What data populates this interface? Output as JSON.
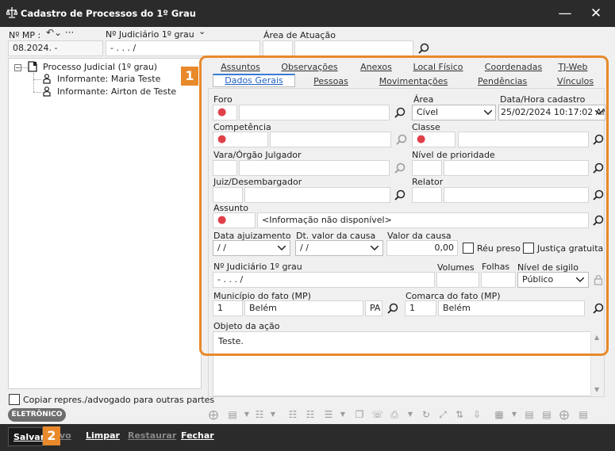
{
  "window": {
    "title": "Cadastro de Processos do 1º Grau"
  },
  "header": {
    "mp_label": "Nº MP :",
    "mp_value": "08.2024.      -",
    "nj_label": "Nº Judiciário   1º grau",
    "nj_value": "      -  .      .    .      /",
    "area_label": "Área de Atuação",
    "area_value": ""
  },
  "tree": {
    "root": "Processo Judicial (1º grau)",
    "children": [
      "Informante: Maria Teste",
      "Informante: Airton de Teste"
    ]
  },
  "copy_checkbox_label": "Copiar repres./advogado para outras partes",
  "eletronico_badge": "ELETRÔNICO",
  "tabs_top": [
    "Assuntos",
    "Observações",
    "Anexos",
    "Local Físico",
    "Coordenadas",
    "TJ-Web"
  ],
  "tabs_bottom": [
    "Dados Gerais",
    "Pessoas",
    "Movimentações",
    "Pendências",
    "Vínculos"
  ],
  "badges": {
    "one": "1",
    "two": "2"
  },
  "form": {
    "foro_label": "Foro",
    "area_label": "Área",
    "area_value": "Cível",
    "data_cad_label": "Data/Hora cadastro",
    "data_cad_value": "25/02/2024 10:17:02 AM",
    "competencia_label": "Competência",
    "classe_label": "Classe",
    "vara_label": "Vara/Órgão Julgador",
    "prioridade_label": "Nível de prioridade",
    "juiz_label": "Juiz/Desembargador",
    "relator_label": "Relator",
    "assunto_label": "Assunto",
    "assunto_value": "<Informação não disponível>",
    "data_ajuiz_label": "Data ajuizamento",
    "data_ajuiz_value": " /  /",
    "dt_valor_label": "Dt. valor da causa",
    "dt_valor_value": " /  /",
    "valor_label": "Valor da causa",
    "valor_value": "0,00",
    "reu_preso_label": "Réu preso",
    "justica_label": "Justiça gratuita",
    "nj_label": "Nº Judiciário  1º grau",
    "nj_value": "      -  .      .    .      /",
    "volumes_label": "Volumes",
    "folhas_label": "Folhas",
    "sigilo_label": "Nível de sigilo",
    "sigilo_value": "Público",
    "municipio_label": "Município do fato (MP)",
    "municipio_code": "1",
    "municipio_name": "Belém",
    "municipio_uf": "PA",
    "comarca_label": "Comarca do fato (MP)",
    "comarca_code": "1",
    "comarca_name": "Belém",
    "objeto_label": "Objeto da ação",
    "objeto_value": "Teste."
  },
  "bottom_buttons": {
    "salvar": "Salvar",
    "novo": "vo",
    "limpar": "Limpar",
    "restaurar": "Restaurar",
    "fechar": "Fechar"
  },
  "colors": {
    "accent": "#e8892b",
    "titlebar": "#2b2b2b",
    "required": "#e0404a"
  }
}
